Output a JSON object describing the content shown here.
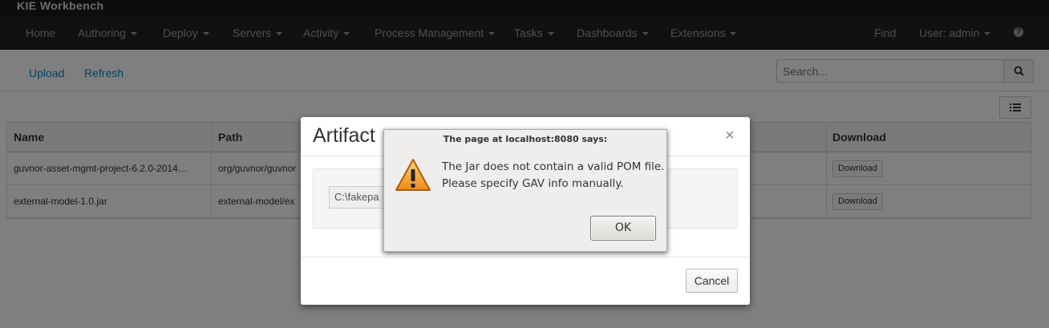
{
  "app": {
    "brand": "KIE Workbench"
  },
  "nav": {
    "home": "Home",
    "authoring": "Authoring",
    "deploy": "Deploy",
    "servers": "Servers",
    "activity": "Activity",
    "process_management": "Process Management",
    "tasks": "Tasks",
    "dashboards": "Dashboards",
    "extensions": "Extensions",
    "find": "Find",
    "user": "User: admin"
  },
  "toolbar": {
    "upload": "Upload",
    "refresh": "Refresh",
    "search_placeholder": "Search..."
  },
  "table": {
    "columns": {
      "name": "Name",
      "path": "Path",
      "download": "Download"
    },
    "rows": [
      {
        "name": "guvnor-asset-mgmt-project-6.2.0-2014…",
        "path": "org/guvnor/guvnor",
        "action": "Download"
      },
      {
        "name": "external-model-1.0.jar",
        "path": "external-model/ex",
        "action": "Download"
      }
    ]
  },
  "modal": {
    "title": "Artifact",
    "file_value": "C:\\fakepa",
    "cancel": "Cancel"
  },
  "alert": {
    "title": "The page at localhost:8080 says:",
    "line1": "The Jar does not contain a valid POM file.",
    "line2": "Please specify GAV info manually.",
    "ok": "OK"
  },
  "colors": {
    "navbar": "#222222",
    "link": "#0088ce",
    "backdrop": "rgba(0,0,0,0.5)"
  },
  "icons": {
    "search": "search-icon",
    "list": "list-icon",
    "help": "help-icon",
    "close": "close-icon",
    "warning": "warning-icon"
  }
}
